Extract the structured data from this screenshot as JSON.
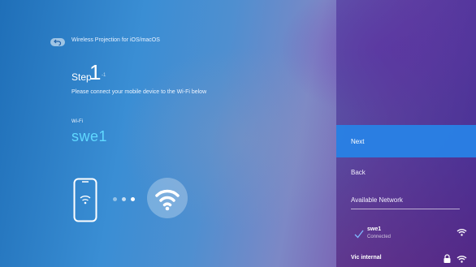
{
  "header": {
    "title": "Wireless Projection for iOS/macOS"
  },
  "step": {
    "label": "Step",
    "number": "1",
    "sub": "-1"
  },
  "instruction": "Please connect your mobile device to the Wi-Fi below",
  "wifi": {
    "label": "Wi-Fi",
    "ssid": "swe1"
  },
  "menu": {
    "next_label": "Next",
    "back_label": "Back",
    "available_label": "Available Network"
  },
  "networks": [
    {
      "name": "swe1",
      "status": "Connected",
      "secured": false,
      "connected": true
    },
    {
      "name": "Vic internal",
      "status": "",
      "secured": true,
      "connected": false
    }
  ],
  "colors": {
    "accent": "#2882e6",
    "ssid": "#5fd8ff"
  }
}
